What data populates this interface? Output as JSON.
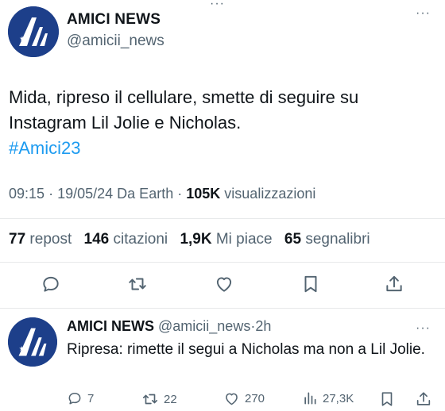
{
  "main_tweet": {
    "author_name": "AMICI NEWS",
    "author_handle": "@amicii_news",
    "more_symbol": "···",
    "text_line1": "Mida, ripreso il cellulare, smette di seguire su",
    "text_line2": "Instagram Lil Jolie e Nicholas.",
    "hashtag": "#Amici23",
    "time": "09:15",
    "date": "19/05/24",
    "source": "Da Earth",
    "views_count": "105K",
    "views_label": "visualizzazioni",
    "separator": "·"
  },
  "stats": {
    "reposts_count": "77",
    "reposts_label": "repost",
    "quotes_count": "146",
    "quotes_label": "citazioni",
    "likes_count": "1,9K",
    "likes_label": "Mi piace",
    "bookmarks_count": "65",
    "bookmarks_label": "segnalibri"
  },
  "actions": {
    "icons": [
      "reply-icon",
      "repost-icon",
      "like-icon",
      "bookmark-icon",
      "share-icon"
    ]
  },
  "reply_tweet": {
    "author_name": "AMICI NEWS",
    "author_handle": "@amicii_news",
    "separator": "·",
    "time": "2h",
    "more_symbol": "···",
    "text": "Ripresa: rimette il segui a Nicholas ma non a Lil Jolie.",
    "replies_count": "7",
    "reposts_count": "22",
    "likes_count": "270",
    "views_count": "27,3K"
  },
  "colors": {
    "accent": "#1d9bf0",
    "text": "#0f1419",
    "secondary": "#536471",
    "avatar_bg": "#1d3f8a",
    "divider": "#e7e9ea"
  }
}
